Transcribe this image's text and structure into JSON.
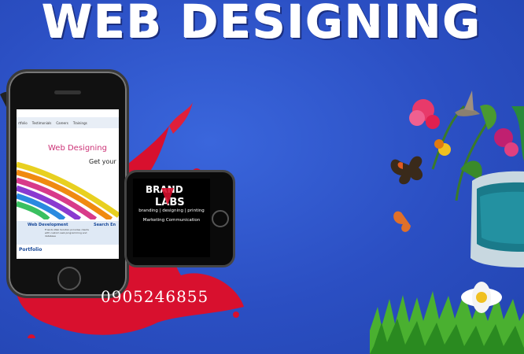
{
  "headline": "WEB DESIGNING",
  "phone_number": "0905246855",
  "phone_screen": {
    "nav": [
      "rtfolio",
      "Testimonials",
      "Careers",
      "Trainings"
    ],
    "title": "Web Designing",
    "subtitle": "Get your",
    "section_left": "Web Development",
    "section_right": "Search En",
    "section_text": "Friends Web Solution provides clients with custom web programming and database",
    "more": "more",
    "portfolio": "Portfolio"
  },
  "brand_phone": {
    "logo": "BRAND LABS",
    "line1": "branding | designing | printing",
    "line2": "Marketing  Communication"
  },
  "colors": {
    "background": "#2c52c6",
    "splash": "#d8102e",
    "headline": "#ffffff"
  },
  "icons": [
    "smartphone",
    "hummingbird",
    "butterfly",
    "flowers",
    "grass",
    "daisy",
    "monitor"
  ]
}
